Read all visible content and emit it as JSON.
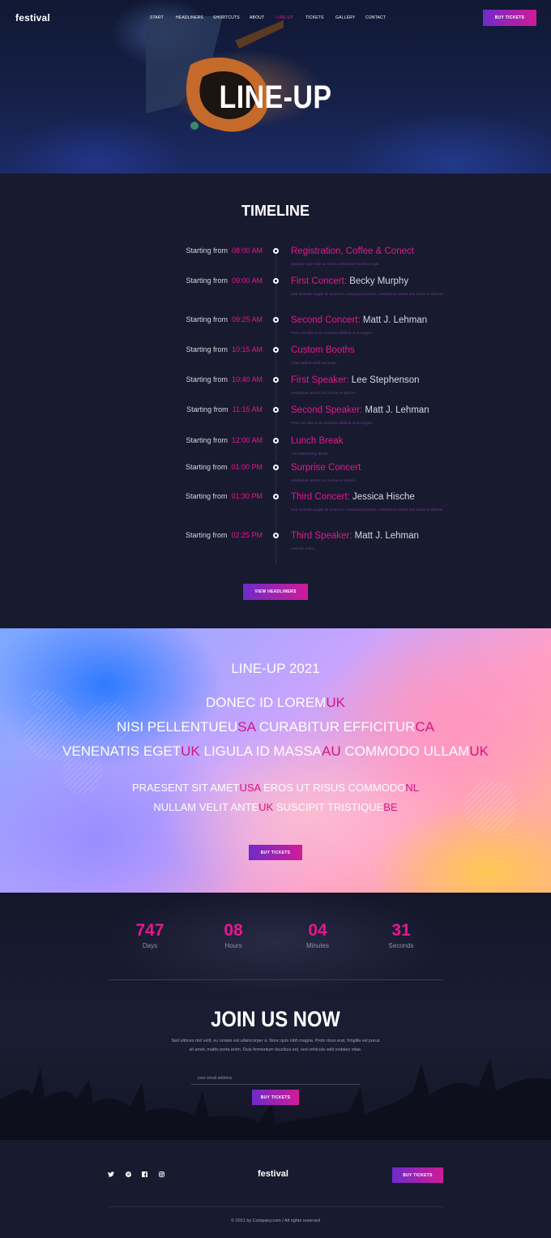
{
  "brand": {
    "logo": "festival",
    "accent": "#e2198c",
    "button_gradient": [
      "#6f2bc9",
      "#d01b98"
    ]
  },
  "nav": {
    "items": [
      {
        "label": "START"
      },
      {
        "label": "HEADLINERS"
      },
      {
        "label": "SHORTCUTS"
      },
      {
        "label": "ABOUT"
      },
      {
        "label": "LINE-UP",
        "active": true
      },
      {
        "label": "TICKETS"
      },
      {
        "label": "GALLERY"
      },
      {
        "label": "CONTACT"
      }
    ],
    "cta": "BUY TICKETS"
  },
  "hero": {
    "title": "LINE-UP"
  },
  "timeline": {
    "title": "TIMELINE",
    "prefix": "Starting from",
    "items": [
      {
        "time": "08:00 AM",
        "title": "Registration, Coffee & Conect",
        "name": "",
        "desc": "Quisque eget odio ac lectus vestibulum faucibus eget."
      },
      {
        "time": "09:00 AM",
        "title": "First Concert:",
        "name": " Becky Murphy",
        "desc": "Sed molestie augue sit amet leo consequat posuere. Vestibulum antest orci luctus et ultrices."
      },
      {
        "time": "09:25 AM",
        "title": "Second Concert:",
        "name": " Matt J. Lehman",
        "desc": "Proin vel ante a orci tempus eleifend ut et magna."
      },
      {
        "time": "10:15 AM",
        "title": "Custom Booths",
        "name": "",
        "desc": "Class aptent taciti sociosqu."
      },
      {
        "time": "10:40 AM",
        "title": "First Speaker:",
        "name": " Lee Stephenson",
        "desc": "Vestibulum antest orci luctus et ultrices."
      },
      {
        "time": "11:15 AM",
        "title": "Second Speaker:",
        "name": " Matt J. Lehman",
        "desc": "Proin vel ante a orci tempus eleifend ut et magna."
      },
      {
        "time": "12:00 AM",
        "title": "Lunch Break",
        "name": "",
        "desc": "+30 Networking Break"
      },
      {
        "time": "01:00 PM",
        "title": "Surprise Concert",
        "name": "",
        "desc": "Vestibulum antest orci luctus et ultrices."
      },
      {
        "time": "01:30 PM",
        "title": "Third Concert:",
        "name": " Jessica Hische",
        "desc": "Sed molestie augue sit amet leo consequat posuere. Vestibulum antest orci luctus et ultrices."
      },
      {
        "time": "02:25 PM",
        "title": "Third Speaker:",
        "name": " Matt J. Lehman",
        "desc": "And lots more..."
      }
    ],
    "cta": "VIEW HEADLINERS"
  },
  "lineup": {
    "title": "LINE-UP 2021",
    "line1": [
      {
        "t": "DONEC ID LOREM"
      },
      {
        "t": "UK",
        "c": true
      }
    ],
    "line2": [
      {
        "t": "NISI PELLENTUEU"
      },
      {
        "t": "SA",
        "c": true
      },
      {
        "t": " CURABITUR EFFICITUR"
      },
      {
        "t": "CA",
        "c": true
      }
    ],
    "line3": [
      {
        "t": "VENENATIS EGET"
      },
      {
        "t": "UK",
        "c": true
      },
      {
        "t": " LIGULA ID MASSA"
      },
      {
        "t": "AU",
        "c": true
      },
      {
        "t": " COMMODO ULLAM"
      },
      {
        "t": "UK",
        "c": true
      }
    ],
    "line4": [
      {
        "t": "PRAESENT SIT AMET"
      },
      {
        "t": "USA",
        "c": true
      },
      {
        "t": " EROS UT RISUS COMMODO"
      },
      {
        "t": "NL",
        "c": true
      }
    ],
    "line5": [
      {
        "t": "NULLAM VELIT ANTE"
      },
      {
        "t": "UK",
        "c": true
      },
      {
        "t": " SUSCIPIT TRISTIQUE"
      },
      {
        "t": "BE",
        "c": true
      }
    ],
    "cta": "BUY TICKETS"
  },
  "countdown": [
    {
      "value": "747",
      "label": "Days"
    },
    {
      "value": "08",
      "label": "Hours"
    },
    {
      "value": "04",
      "label": "Minutes"
    },
    {
      "value": "31",
      "label": "Seconds"
    }
  ],
  "join": {
    "title": "JOIN US NOW",
    "text": "Sed ultrices nisl velit, eu ornare est ullamcorper a. Nunc quis nibh magna. Proin risus erat, fringilla vel purus sit amet, mattis porta enim. Duis fermentum faucibus est, sed vehicula velit sodales vitae.",
    "email_placeholder": "your email address",
    "cta": "BUY TICKETS"
  },
  "footer": {
    "social": [
      "twitter-icon",
      "pinterest-icon",
      "facebook-icon",
      "instagram-icon"
    ],
    "logo": "festival",
    "cta": "BUY TICKETS",
    "copyright": "©  2021 by Company.com  /  All rights reserved"
  }
}
